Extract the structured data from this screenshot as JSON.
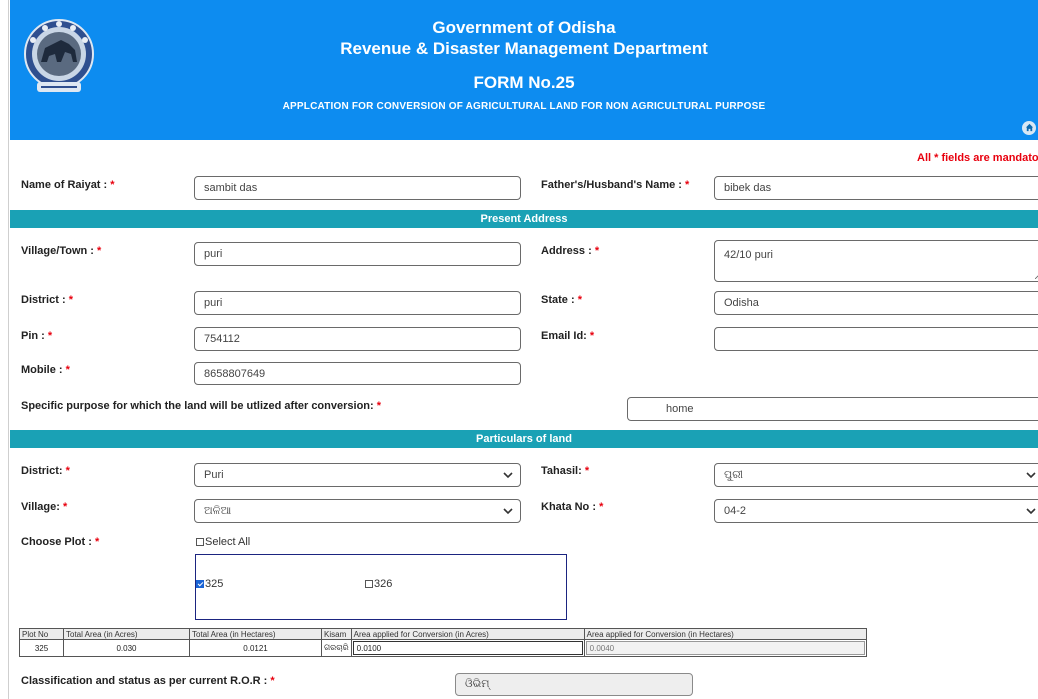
{
  "header": {
    "line1": "Government of Odisha",
    "line2": "Revenue & Disaster Management Department",
    "form_no": "FORM No.25",
    "subtitle": "APPLCATION FOR CONVERSION OF AGRICULTURAL LAND FOR NON AGRICULTURAL PURPOSE",
    "bg_color": "#0d8cf0",
    "emblem_icon": "odisha-emblem",
    "home_icon": "home-icon"
  },
  "mandatory_note": "All * fields are mandatory",
  "required_mark": "*",
  "applicant": {
    "raiyat_label": "Name of Raiyat :",
    "raiyat_value": "sambit das",
    "father_label": "Father's/Husband's Name :",
    "father_value": "bibek das"
  },
  "present_address": {
    "section_title": "Present Address",
    "village_label": "Village/Town :",
    "village_value": "puri",
    "address_label": "Address :",
    "address_value": "42/10 puri",
    "district_label": "District :",
    "district_value": "puri",
    "state_label": "State :",
    "state_value": "Odisha",
    "pin_label": "Pin :",
    "pin_value": "754112",
    "email_label": "Email Id:",
    "email_value": "",
    "mobile_label": "Mobile :",
    "mobile_value": "8658807649",
    "purpose_label": "Specific purpose for which the land will be utlized after conversion:",
    "purpose_value": "home"
  },
  "land": {
    "section_title": "Particulars of land",
    "district_label": "District:",
    "district_value": "Puri",
    "tahasil_label": "Tahasil:",
    "tahasil_value": "ପୁରୀ",
    "village_label": "Village:",
    "village_value": "ଅଳିଆ",
    "khata_label": "Khata No :",
    "khata_value": "04-2",
    "plot_label": "Choose Plot :",
    "select_all": "Select All",
    "plots": [
      {
        "no": "325",
        "checked": true
      },
      {
        "no": "326",
        "checked": false
      }
    ],
    "table_headers": [
      "Plot No",
      "Total Area (in Acres)",
      "Total Area (in Hectares)",
      "Kisam",
      "Area applied for Conversion (in Acres)",
      "Area applied for Conversion (in Hectares)"
    ],
    "rows": [
      {
        "plot_no": "325",
        "acres": "0.030",
        "hectares": "0.0121",
        "kisam": "ଗରଚାରି",
        "applied_acres": "0.0100",
        "applied_hectares": "0.0040"
      }
    ],
    "ror_label": "Classification and status as per current R.O.R :",
    "ror_value": "ଓିଭିମ୍"
  },
  "colors": {
    "section_bar": "#1aa1b5",
    "required": "#e8000e",
    "accent": "#0d8cf0"
  }
}
